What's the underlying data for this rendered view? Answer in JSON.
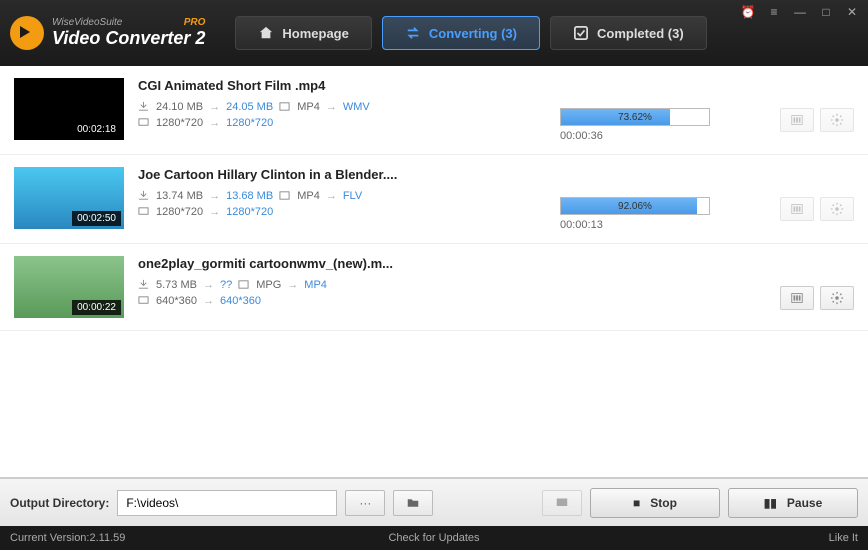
{
  "app": {
    "suite": "WiseVideoSuite",
    "pro": "PRO",
    "name": "Video Converter 2"
  },
  "tabs": {
    "homepage": "Homepage",
    "converting": "Converting (3)",
    "completed": "Completed (3)"
  },
  "items": [
    {
      "title": "CGI Animated Short Film .mp4",
      "duration": "00:02:18",
      "size_in": "24.10 MB",
      "size_out": "24.05 MB",
      "fmt_in": "MP4",
      "fmt_out": "WMV",
      "res_in": "1280*720",
      "res_out": "1280*720",
      "progress": "73.62%",
      "progress_pct": 73.62,
      "remaining": "00:00:36",
      "thumb_class": "",
      "show_progress": true
    },
    {
      "title": "Joe Cartoon  Hillary Clinton in a Blender....",
      "duration": "00:02:50",
      "size_in": "13.74 MB",
      "size_out": "13.68 MB",
      "fmt_in": "MP4",
      "fmt_out": "FLV",
      "res_in": "1280*720",
      "res_out": "1280*720",
      "progress": "92.06%",
      "progress_pct": 92.06,
      "remaining": "00:00:13",
      "thumb_class": "blue",
      "show_progress": true
    },
    {
      "title": "one2play_gormiti cartoonwmv_(new).m...",
      "duration": "00:00:22",
      "size_in": "5.73 MB",
      "size_out": "??",
      "fmt_in": "MPG",
      "fmt_out": "MP4",
      "res_in": "640*360",
      "res_out": "640*360",
      "progress": "",
      "progress_pct": 0,
      "remaining": "",
      "thumb_class": "green",
      "show_progress": false
    }
  ],
  "output": {
    "label": "Output Directory:",
    "path": "F:\\videos\\",
    "browse": "···"
  },
  "controls": {
    "stop": "Stop",
    "pause": "Pause"
  },
  "status": {
    "version_label": "Current Version:",
    "version": "2.11.59",
    "updates": "Check for Updates",
    "like": "Like It"
  }
}
